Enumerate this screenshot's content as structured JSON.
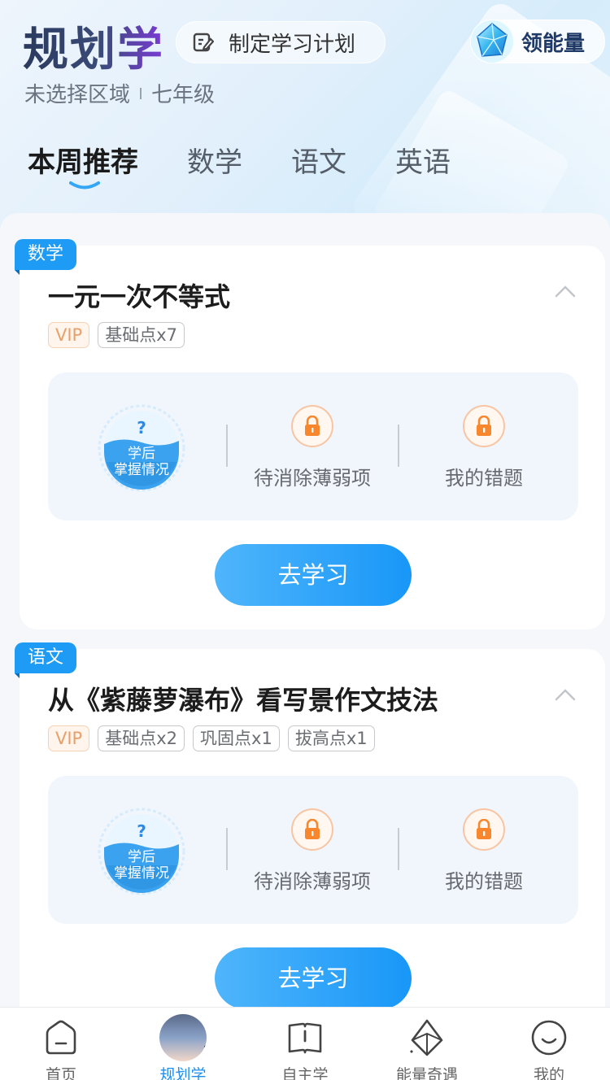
{
  "header": {
    "brand": "规划学",
    "plan_button": "制定学习计划",
    "energy_button": "领能量",
    "region": "未选择区域",
    "grade": "七年级",
    "tabs": [
      "本周推荐",
      "数学",
      "语文",
      "英语"
    ]
  },
  "cards": [
    {
      "subject": "数学",
      "title": "一元一次不等式",
      "tags": [
        "VIP",
        "基础点x7"
      ],
      "mastery_mark": "?",
      "mastery_line1": "学后",
      "mastery_line2": "掌握情况",
      "weak_items": "待消除薄弱项",
      "my_mistakes": "我的错题",
      "study_button": "去学习"
    },
    {
      "subject": "语文",
      "title": "从《紫藤萝瀑布》看写景作文技法",
      "tags": [
        "VIP",
        "基础点x2",
        "巩固点x1",
        "拔高点x1"
      ],
      "mastery_mark": "?",
      "mastery_line1": "学后",
      "mastery_line2": "掌握情况",
      "weak_items": "待消除薄弱项",
      "my_mistakes": "我的错题",
      "study_button": "去学习"
    }
  ],
  "bottom_nav": [
    {
      "label": "首页",
      "icon": "home-icon"
    },
    {
      "label": "规划学",
      "icon": "avatar",
      "active": true
    },
    {
      "label": "自主学",
      "icon": "book-icon"
    },
    {
      "label": "能量奇遇",
      "icon": "crystal-icon"
    },
    {
      "label": "我的",
      "icon": "smile-icon"
    }
  ],
  "colors": {
    "accent": "#1e9bf5",
    "vip": "#e8a06a",
    "lock": "#f7862c"
  }
}
